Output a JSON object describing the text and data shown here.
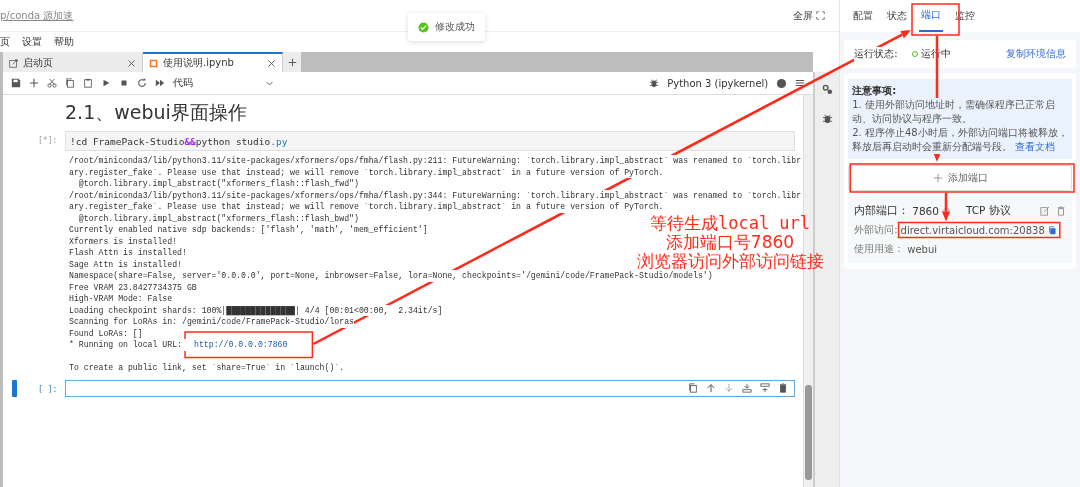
{
  "top_bar": {
    "link": "p/conda 源加速",
    "fullscreen": "全屏"
  },
  "toast": {
    "message": "修改成功"
  },
  "menu": [
    "页",
    "设置",
    "帮助"
  ],
  "tabs": [
    {
      "label": "启动页",
      "selected": false
    },
    {
      "label": "使用说明.ipynb",
      "selected": true
    }
  ],
  "toolbar": {
    "cell_type": "代码",
    "kernel": "Python 3 (ipykernel)",
    "kernel_busy": true
  },
  "notebook": {
    "heading": "2.1、webui界面操作",
    "cells": [
      {
        "prompt": "[*]:",
        "active": false,
        "code": [
          {
            "text": "!cd FramePack-Studio",
            "kind": "plain"
          },
          {
            "text": "&&",
            "kind": "operator"
          },
          {
            "text": "python studio",
            "kind": "plain"
          },
          {
            "text": ".py",
            "kind": "attr"
          }
        ],
        "output": [
          "/root/miniconda3/lib/python3.11/site-packages/xformers/ops/fmha/flash.py:211: FutureWarning: `torch.library.impl_abstract` was renamed to `torch.libr",
          "ary.register_fake`. Please use that instead; we will remove `torch.library.impl_abstract` in a future version of PyTorch.",
          "  @torch.library.impl_abstract(\"xformers_flash::flash_fwd\")",
          "/root/miniconda3/lib/python3.11/site-packages/xformers/ops/fmha/flash.py:344: FutureWarning: `torch.library.impl_abstract` was renamed to `torch.libr",
          "ary.register_fake`. Please use that instead; we will remove `torch.library.impl_abstract` in a future version of PyTorch.",
          "  @torch.library.impl_abstract(\"xformers_flash::flash_bwd\")",
          "Currently enabled native sdp backends: ['flash', 'math', 'mem_efficient']",
          "Xformers is installed!",
          "Flash Attn is installed!",
          "Sage Attn is installed!",
          "Namespace(share=False, server='0.0.0.0', port=None, inbrowser=False, lora=None, checkpoints='/gemini/code/FramePack-Studio/models')",
          "Free VRAM 23.8427734375 GB",
          "High-VRAM Mode: False",
          "Loading checkpoint shards: 100%|██████████████| 4/4 [00:01<00:00,  2.34it/s]",
          "Scanning for LoRAs in: /gemini/code/FramePack-Studio/loras",
          "Found LoRAs: []"
        ],
        "url_line": {
          "text": "* Running on local URL:",
          "link": "http://0.0.0.0:7860"
        },
        "output_end": [
          "To create a public link, set `share=True` in `launch()`."
        ]
      },
      {
        "prompt": "[ ]:",
        "active": true
      }
    ]
  },
  "panel": {
    "tabs": [
      {
        "label": "配置",
        "selected": false
      },
      {
        "label": "状态",
        "selected": false
      },
      {
        "label": "端口",
        "selected": true
      },
      {
        "label": "监控",
        "selected": false
      }
    ],
    "status": {
      "label": "运行状态:",
      "value": "运行中",
      "link": "复制环境信息"
    },
    "notes": {
      "title": "注意事项:",
      "items": [
        "1. 使用外部访问地址时，需确保程序已正常启动、访问协议与程序一致。",
        "2. 程序停止48小时后，外部访问端口将被释放，释放后再启动时会重新分配端号段。"
      ],
      "link": "查看文档"
    },
    "add_button": "添加端口",
    "port": {
      "internal_label": "内部端口：",
      "internal_value": "7860",
      "protocol": "TCP 协议",
      "external_label": "外部访问:",
      "external_value": "direct.virtaicloud.com:20838",
      "usage_label": "使用用途：",
      "usage_value": "webui"
    }
  },
  "annotations": {
    "texts": [
      "等待生成local url",
      "添加端口号7860",
      "浏览器访问外部访问链接"
    ]
  }
}
